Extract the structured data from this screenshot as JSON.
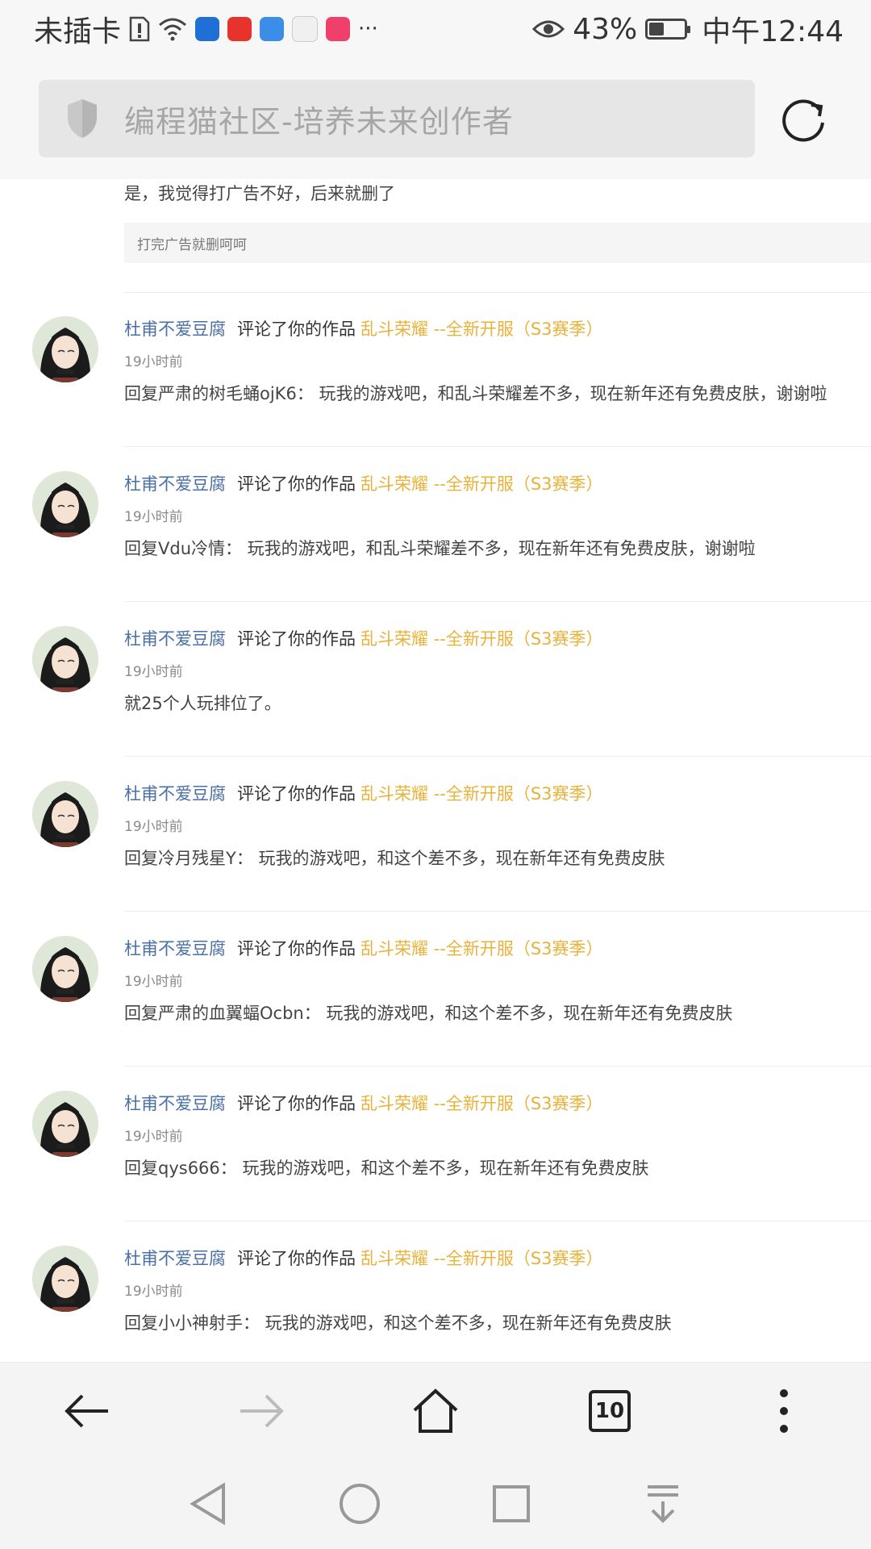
{
  "status_bar": {
    "carrier": "未插卡",
    "battery_percent": "43%",
    "battery_level": 0.43,
    "time": "中午12:44",
    "more": "···"
  },
  "browser": {
    "url_text": "编程猫社区-培养未来创作者",
    "tab_count": "10"
  },
  "partial_reply": {
    "text": "是，我觉得打广告不好，后来就删了",
    "quote": "打完广告就删呵呵"
  },
  "notifications": [
    {
      "user": "杜甫不爱豆腐",
      "action": "评论了你的作品",
      "work": "乱斗荣耀 --全新开服（S3赛季）",
      "time": "19小时前",
      "comment": "回复严肃的树毛蛹ojK6：  玩我的游戏吧，和乱斗荣耀差不多，现在新年还有免费皮肤，谢谢啦"
    },
    {
      "user": "杜甫不爱豆腐",
      "action": "评论了你的作品",
      "work": "乱斗荣耀 --全新开服（S3赛季）",
      "time": "19小时前",
      "comment": "回复Vdu冷情：  玩我的游戏吧，和乱斗荣耀差不多，现在新年还有免费皮肤，谢谢啦"
    },
    {
      "user": "杜甫不爱豆腐",
      "action": "评论了你的作品",
      "work": "乱斗荣耀 --全新开服（S3赛季）",
      "time": "19小时前",
      "comment": "就25个人玩排位了。"
    },
    {
      "user": "杜甫不爱豆腐",
      "action": "评论了你的作品",
      "work": "乱斗荣耀 --全新开服（S3赛季）",
      "time": "19小时前",
      "comment": "回复冷月残星Y：  玩我的游戏吧，和这个差不多，现在新年还有免费皮肤"
    },
    {
      "user": "杜甫不爱豆腐",
      "action": "评论了你的作品",
      "work": "乱斗荣耀 --全新开服（S3赛季）",
      "time": "19小时前",
      "comment": "回复严肃的血翼蝠Ocbn：  玩我的游戏吧，和这个差不多，现在新年还有免费皮肤"
    },
    {
      "user": "杜甫不爱豆腐",
      "action": "评论了你的作品",
      "work": "乱斗荣耀 --全新开服（S3赛季）",
      "time": "19小时前",
      "comment": "回复qys666：  玩我的游戏吧，和这个差不多，现在新年还有免费皮肤"
    },
    {
      "user": "杜甫不爱豆腐",
      "action": "评论了你的作品",
      "work": "乱斗荣耀 --全新开服（S3赛季）",
      "time": "19小时前",
      "comment": "回复小小神射手：  玩我的游戏吧，和这个差不多，现在新年还有免费皮肤"
    }
  ],
  "colors": {
    "user_link": "#4a6fa5",
    "work_link": "#e7b23a",
    "timestamp": "#8a8a8a"
  }
}
